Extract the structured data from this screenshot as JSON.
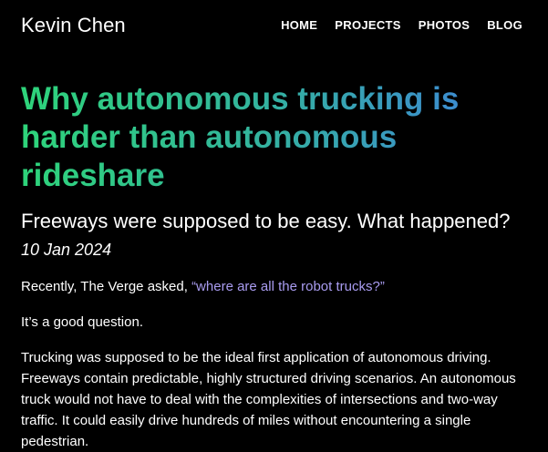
{
  "header": {
    "site_name": "Kevin Chen",
    "nav": [
      {
        "label": "HOME"
      },
      {
        "label": "PROJECTS"
      },
      {
        "label": "PHOTOS"
      },
      {
        "label": "BLOG"
      }
    ]
  },
  "article": {
    "title": "Why autonomous trucking is harder than autonomous rideshare",
    "subtitle": "Freeways were supposed to be easy. What happened?",
    "date": "10 Jan 2024",
    "paragraphs": {
      "p1_text": "Recently, The Verge asked, ",
      "p1_link": "“where are all the robot trucks?”",
      "p2": "It’s a good question.",
      "p3": "Trucking was supposed to be the ideal first application of autonomous driving. Freeways contain predictable, highly structured driving scenarios. An autonomous truck would not have to deal with the complexities of intersections and two-way traffic. It could easily drive hundreds of miles without encountering a single pedestrian."
    }
  },
  "colors": {
    "background": "#000000",
    "text": "#ffffff",
    "title_gradient_start": "#2ed47a",
    "title_gradient_end": "#3f7fe0",
    "link": "#a99cf0"
  }
}
